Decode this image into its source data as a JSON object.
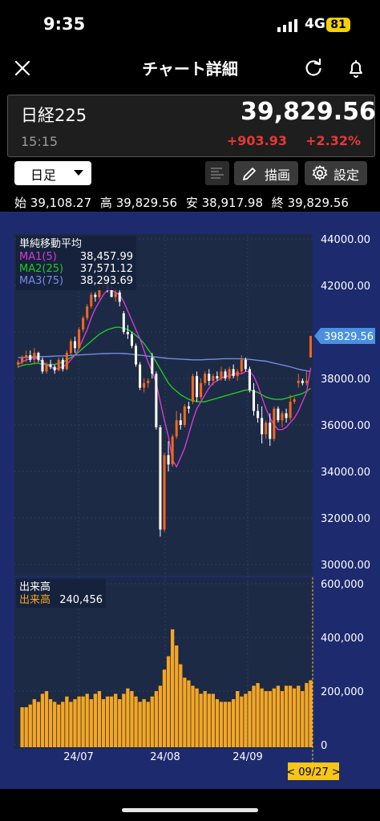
{
  "status_bar": {
    "time": "9:35",
    "network": "4G",
    "battery": "81"
  },
  "nav": {
    "title": "チャート詳細"
  },
  "quote": {
    "name": "日経225",
    "price": "39,829.56",
    "time": "15:15",
    "change": "+903.93",
    "change_pct": "+2.32%"
  },
  "toolbar": {
    "period": "日足",
    "draw_label": "描画",
    "settings_label": "設定"
  },
  "ohlc": {
    "open_label": "始",
    "open": "39,108.27",
    "high_label": "高",
    "high": "39,829.56",
    "low_label": "安",
    "low": "38,917.98",
    "close_label": "終",
    "close": "39,829.56"
  },
  "legend_ma": {
    "title": "単純移動平均",
    "items": [
      {
        "label": "MA1(5)",
        "value": "38,457.99",
        "color": "#d63ad6"
      },
      {
        "label": "MA2(25)",
        "value": "37,571.12",
        "color": "#22c822"
      },
      {
        "label": "MA3(75)",
        "value": "38,293.69",
        "color": "#7a88e8"
      }
    ]
  },
  "legend_vol": {
    "title": "出来高",
    "label": "出来高",
    "value": "240,456",
    "color": "#f5a623"
  },
  "price_axis": {
    "ticks": [
      "44000.00",
      "42000.00",
      "40000.00",
      "38000.00",
      "36000.00",
      "34000.00",
      "32000.00",
      "30000.00"
    ],
    "current": "39829.56"
  },
  "volume_axis": {
    "ticks": [
      "600,000",
      "400,000",
      "200,000",
      "0"
    ]
  },
  "date_axis": {
    "labels": [
      "24/07",
      "24/08",
      "24/09"
    ],
    "cursor": "< 09/27 >"
  },
  "colors": {
    "up": "#f5661e",
    "down": "#ffffff",
    "panel_bg": "#1c2a45",
    "frame_bg": "#1e2a6e",
    "volume": "#f5a623"
  },
  "chart_data": {
    "type": "candlestick",
    "title": "",
    "ylim": [
      30000,
      44000
    ],
    "volume_ylim": [
      0,
      600000
    ],
    "x_labels": [
      "24/07",
      "24/08",
      "24/09"
    ],
    "candles": [
      {
        "o": 38600,
        "h": 38800,
        "l": 38450,
        "c": 38700
      },
      {
        "o": 38700,
        "h": 39000,
        "l": 38600,
        "c": 38900
      },
      {
        "o": 38900,
        "h": 39200,
        "l": 38700,
        "c": 39000
      },
      {
        "o": 39000,
        "h": 39200,
        "l": 38700,
        "c": 38800
      },
      {
        "o": 38800,
        "h": 39300,
        "l": 38600,
        "c": 39100
      },
      {
        "o": 39100,
        "h": 39150,
        "l": 38700,
        "c": 38800
      },
      {
        "o": 38800,
        "h": 38900,
        "l": 38200,
        "c": 38300
      },
      {
        "o": 38300,
        "h": 38700,
        "l": 38200,
        "c": 38600
      },
      {
        "o": 38600,
        "h": 38800,
        "l": 38400,
        "c": 38500
      },
      {
        "o": 38500,
        "h": 38600,
        "l": 38200,
        "c": 38350
      },
      {
        "o": 38350,
        "h": 38900,
        "l": 38300,
        "c": 38800
      },
      {
        "o": 38800,
        "h": 38900,
        "l": 38300,
        "c": 38400
      },
      {
        "o": 38400,
        "h": 39200,
        "l": 38350,
        "c": 39100
      },
      {
        "o": 39100,
        "h": 39700,
        "l": 39000,
        "c": 39600
      },
      {
        "o": 39600,
        "h": 39800,
        "l": 39100,
        "c": 39300
      },
      {
        "o": 39300,
        "h": 40200,
        "l": 39250,
        "c": 40100
      },
      {
        "o": 40100,
        "h": 40700,
        "l": 40000,
        "c": 40600
      },
      {
        "o": 40600,
        "h": 41200,
        "l": 40500,
        "c": 41100
      },
      {
        "o": 41100,
        "h": 41700,
        "l": 41000,
        "c": 41600
      },
      {
        "o": 41600,
        "h": 41700,
        "l": 41300,
        "c": 41500
      },
      {
        "o": 41500,
        "h": 42100,
        "l": 41400,
        "c": 41900
      },
      {
        "o": 41900,
        "h": 42400,
        "l": 41800,
        "c": 42200
      },
      {
        "o": 42200,
        "h": 42300,
        "l": 41700,
        "c": 41800
      },
      {
        "o": 41800,
        "h": 42200,
        "l": 41600,
        "c": 41500
      },
      {
        "o": 41500,
        "h": 41900,
        "l": 41300,
        "c": 41700
      },
      {
        "o": 41700,
        "h": 41900,
        "l": 41100,
        "c": 41300
      },
      {
        "o": 40800,
        "h": 40900,
        "l": 39900,
        "c": 40000
      },
      {
        "o": 40000,
        "h": 40300,
        "l": 39700,
        "c": 39900
      },
      {
        "o": 39900,
        "h": 40000,
        "l": 39300,
        "c": 39400
      },
      {
        "o": 39400,
        "h": 39500,
        "l": 38500,
        "c": 38600
      },
      {
        "o": 38600,
        "h": 38700,
        "l": 37500,
        "c": 37600
      },
      {
        "o": 37600,
        "h": 38000,
        "l": 37400,
        "c": 37800
      },
      {
        "o": 37800,
        "h": 38000,
        "l": 37600,
        "c": 37900
      },
      {
        "o": 38900,
        "h": 39100,
        "l": 38000,
        "c": 38200
      },
      {
        "o": 38200,
        "h": 38300,
        "l": 35800,
        "c": 35900
      },
      {
        "o": 35900,
        "h": 36000,
        "l": 31200,
        "c": 31500
      },
      {
        "o": 31500,
        "h": 34800,
        "l": 31400,
        "c": 34700
      },
      {
        "o": 34700,
        "h": 35300,
        "l": 34000,
        "c": 34300
      },
      {
        "o": 34300,
        "h": 35600,
        "l": 34200,
        "c": 35500
      },
      {
        "o": 35500,
        "h": 36600,
        "l": 35400,
        "c": 36200
      },
      {
        "o": 36200,
        "h": 36500,
        "l": 35800,
        "c": 36000
      },
      {
        "o": 36000,
        "h": 36900,
        "l": 35900,
        "c": 36800
      },
      {
        "o": 36800,
        "h": 37000,
        "l": 36500,
        "c": 36700
      },
      {
        "o": 37000,
        "h": 38200,
        "l": 36900,
        "c": 38100
      },
      {
        "o": 38100,
        "h": 38300,
        "l": 37000,
        "c": 37200
      },
      {
        "o": 37200,
        "h": 38000,
        "l": 37100,
        "c": 37800
      },
      {
        "o": 37800,
        "h": 38300,
        "l": 37700,
        "c": 38200
      },
      {
        "o": 38200,
        "h": 38400,
        "l": 37700,
        "c": 37900
      },
      {
        "o": 37900,
        "h": 38200,
        "l": 37700,
        "c": 38100
      },
      {
        "o": 38100,
        "h": 38300,
        "l": 37900,
        "c": 38000
      },
      {
        "o": 38000,
        "h": 38500,
        "l": 37900,
        "c": 38300
      },
      {
        "o": 38300,
        "h": 38400,
        "l": 37900,
        "c": 38000
      },
      {
        "o": 38000,
        "h": 38500,
        "l": 37900,
        "c": 38400
      },
      {
        "o": 38400,
        "h": 38600,
        "l": 38000,
        "c": 38100
      },
      {
        "o": 38100,
        "h": 38400,
        "l": 37900,
        "c": 38300
      },
      {
        "o": 38300,
        "h": 39000,
        "l": 38200,
        "c": 38800
      },
      {
        "o": 38800,
        "h": 38900,
        "l": 38300,
        "c": 38400
      },
      {
        "o": 38400,
        "h": 38500,
        "l": 37400,
        "c": 37500
      },
      {
        "o": 37500,
        "h": 37800,
        "l": 36400,
        "c": 36600
      },
      {
        "o": 36600,
        "h": 36900,
        "l": 36100,
        "c": 36300
      },
      {
        "o": 36300,
        "h": 36800,
        "l": 35200,
        "c": 35600
      },
      {
        "o": 35600,
        "h": 36200,
        "l": 35400,
        "c": 36100
      },
      {
        "o": 36100,
        "h": 36500,
        "l": 35100,
        "c": 35400
      },
      {
        "o": 35400,
        "h": 36800,
        "l": 35300,
        "c": 36700
      },
      {
        "o": 36700,
        "h": 36800,
        "l": 36100,
        "c": 36200
      },
      {
        "o": 36200,
        "h": 36600,
        "l": 35900,
        "c": 36500
      },
      {
        "o": 36500,
        "h": 36700,
        "l": 36100,
        "c": 36300
      },
      {
        "o": 36300,
        "h": 37300,
        "l": 36200,
        "c": 37000
      },
      {
        "o": 37000,
        "h": 37200,
        "l": 36900,
        "c": 37100
      },
      {
        "o": 37800,
        "h": 38200,
        "l": 37600,
        "c": 37900
      },
      {
        "o": 37900,
        "h": 38000,
        "l": 37700,
        "c": 37800
      },
      {
        "o": 37800,
        "h": 38300,
        "l": 37700,
        "c": 37900
      },
      {
        "o": 38900,
        "h": 39830,
        "l": 38900,
        "c": 39830
      }
    ],
    "ma5": [
      38600,
      38700,
      38800,
      38850,
      38900,
      38850,
      38700,
      38600,
      38500,
      38400,
      38450,
      38500,
      38600,
      38800,
      39000,
      39300,
      39700,
      40100,
      40600,
      41000,
      41300,
      41600,
      41800,
      41800,
      41700,
      41600,
      41300,
      40900,
      40500,
      40100,
      39700,
      39200,
      38700,
      38300,
      37800,
      37000,
      36200,
      35500,
      34500,
      34200,
      34600,
      35000,
      35600,
      36200,
      36700,
      37000,
      37300,
      37600,
      37800,
      37900,
      38000,
      38100,
      38100,
      38200,
      38200,
      38200,
      38300,
      38300,
      38100,
      37700,
      37200,
      36700,
      36300,
      36000,
      35800,
      35800,
      35900,
      36100,
      36300,
      36600,
      37000,
      37400,
      38458
    ],
    "ma25": [
      38500,
      38550,
      38600,
      38600,
      38650,
      38650,
      38600,
      38600,
      38600,
      38600,
      38650,
      38700,
      38800,
      38900,
      39000,
      39150,
      39300,
      39450,
      39600,
      39750,
      39900,
      40000,
      40100,
      40150,
      40200,
      40200,
      40150,
      40100,
      40000,
      39850,
      39700,
      39500,
      39250,
      39000,
      38700,
      38400,
      38100,
      37800,
      37600,
      37450,
      37300,
      37200,
      37100,
      37050,
      37000,
      37000,
      37000,
      37050,
      37100,
      37150,
      37200,
      37250,
      37300,
      37350,
      37400,
      37450,
      37500,
      37500,
      37450,
      37400,
      37300,
      37200,
      37150,
      37100,
      37100,
      37100,
      37150,
      37200,
      37250,
      37300,
      37350,
      37450,
      37571
    ],
    "ma75": [
      38900,
      38900,
      38910,
      38920,
      38930,
      38930,
      38940,
      38940,
      38950,
      38960,
      38970,
      38970,
      38980,
      38990,
      39000,
      39010,
      39020,
      39030,
      39040,
      39050,
      39060,
      39070,
      39070,
      39080,
      39080,
      39080,
      39070,
      39060,
      39040,
      39020,
      39000,
      38980,
      38960,
      38940,
      38920,
      38900,
      38880,
      38860,
      38850,
      38840,
      38830,
      38820,
      38810,
      38800,
      38800,
      38800,
      38810,
      38820,
      38820,
      38830,
      38840,
      38850,
      38850,
      38850,
      38850,
      38840,
      38830,
      38820,
      38800,
      38780,
      38760,
      38740,
      38700,
      38660,
      38620,
      38580,
      38540,
      38500,
      38450,
      38400,
      38360,
      38330,
      38294
    ],
    "volumes": [
      140000,
      140000,
      150000,
      170000,
      160000,
      190000,
      200000,
      170000,
      160000,
      150000,
      160000,
      180000,
      160000,
      170000,
      180000,
      180000,
      190000,
      170000,
      190000,
      200000,
      170000,
      180000,
      180000,
      190000,
      170000,
      190000,
      210000,
      200000,
      180000,
      160000,
      170000,
      160000,
      180000,
      200000,
      220000,
      280000,
      330000,
      430000,
      370000,
      300000,
      250000,
      240000,
      220000,
      210000,
      190000,
      200000,
      190000,
      190000,
      170000,
      160000,
      160000,
      160000,
      170000,
      200000,
      180000,
      190000,
      200000,
      220000,
      230000,
      210000,
      200000,
      200000,
      210000,
      220000,
      200000,
      220000,
      220000,
      210000,
      220000,
      200000,
      230000,
      240456
    ]
  }
}
